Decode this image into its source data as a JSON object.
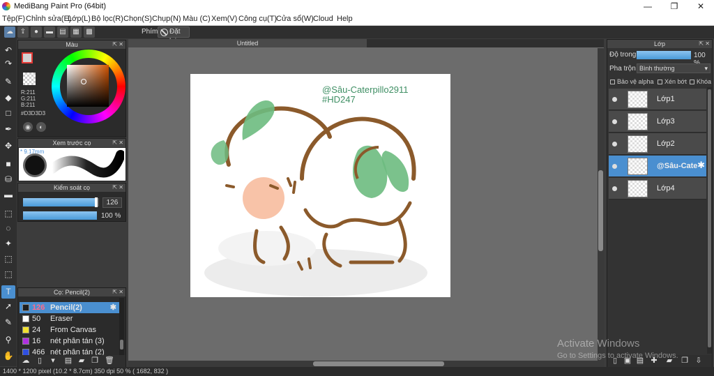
{
  "window": {
    "title": "MediBang Paint Pro (64bit)",
    "minimize": "—",
    "maximize": "❐",
    "close": "✕"
  },
  "menu": [
    "Tệp(F)",
    "Chỉnh sửa(E)",
    "Lớp(L)",
    "Bộ lọc(R)",
    "Chọn(S)",
    "Chụp(N)",
    "Màu (C)",
    "Xem(V)",
    "Công cụ(T)",
    "Cửa sổ(W)",
    "Cloud",
    "Help"
  ],
  "toolbar": {
    "shortcut_label": "Phím",
    "reset_label": "Đặt lại"
  },
  "panels": {
    "color": {
      "title": "Màu",
      "rgb": "R:211\nG:211\nB:211",
      "hex": "#D3D3D3",
      "fg_color": "#d3d3d3",
      "bg_color": "#c62828"
    },
    "brush_preview": {
      "title": "Xem trước cọ",
      "size_label": "* 9.17mm"
    },
    "brush_control": {
      "title": "Kiểm soát cọ",
      "size_value": "126",
      "size_fraction": 0.97,
      "opacity_value": "100 %",
      "opacity_fraction": 1.0
    },
    "brush_list": {
      "title": "Cọ: Pencil(2)",
      "items": [
        {
          "num": "126",
          "name": "Pencil(2)",
          "color": "#1e1e1e",
          "selected": true
        },
        {
          "num": "50",
          "name": "Eraser",
          "color": "#ffffff",
          "selected": false
        },
        {
          "num": "24",
          "name": "From Canvas",
          "color": "#f0e030",
          "selected": false
        },
        {
          "num": "16",
          "name": "nét phân tán (3)",
          "color": "#b030e0",
          "selected": false
        },
        {
          "num": "466",
          "name": "nét phân tán (2)",
          "color": "#3050e0",
          "selected": false
        }
      ]
    }
  },
  "document": {
    "tab_title": "Untitled",
    "watermark_line1": "@Sâu-Caterpillo2911",
    "watermark_line2": "#HD247"
  },
  "layers": {
    "title": "Lớp",
    "opacity_label": "Độ trong",
    "opacity_value": "100 %",
    "blend_label": "Pha trộn",
    "blend_value": "Bình thường",
    "protect_alpha": "Bảo vệ alpha",
    "clipping": "Xén bớt",
    "lock": "Khóa",
    "items": [
      {
        "name": "Lớp1",
        "selected": false
      },
      {
        "name": "Lớp3",
        "selected": false
      },
      {
        "name": "Lớp2",
        "selected": false
      },
      {
        "name": "@Sâu-Cate",
        "selected": true
      },
      {
        "name": "Lớp4",
        "selected": false
      }
    ]
  },
  "status": {
    "text": "1400 * 1200 pixel   (10.2 * 8.7cm)   350 dpi   50 %   ( 1682, 832 )"
  },
  "os_overlay": {
    "line1": "Activate Windows",
    "line2": "Go to Settings to activate Windows."
  }
}
